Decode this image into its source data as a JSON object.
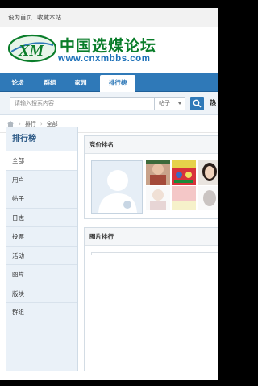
{
  "toplinks": {
    "home": "设为首页",
    "favorite": "收藏本站"
  },
  "logo": {
    "mark": "XM",
    "chinese": "中国选煤论坛",
    "url": "www.cnxmbbs.com"
  },
  "nav": {
    "tabs": [
      "论坛",
      "群组",
      "家园",
      "排行榜"
    ],
    "active": "排行榜"
  },
  "search": {
    "placeholder": "请输入搜索内容",
    "scope": "帖子",
    "hot_label": "热"
  },
  "breadcrumb": {
    "level1": "排行",
    "level2": "全部"
  },
  "sidebar": {
    "title": "排行榜",
    "items": [
      "全部",
      "用户",
      "帖子",
      "日志",
      "投票",
      "活动",
      "图片",
      "版块",
      "群组"
    ]
  },
  "panels": {
    "ranking": "竞价排名",
    "images": "图片排行"
  },
  "colors": {
    "nav": "#2f79b8",
    "logo_green": "#0a7d2a",
    "sidebar_bg": "#eaf1f8"
  }
}
